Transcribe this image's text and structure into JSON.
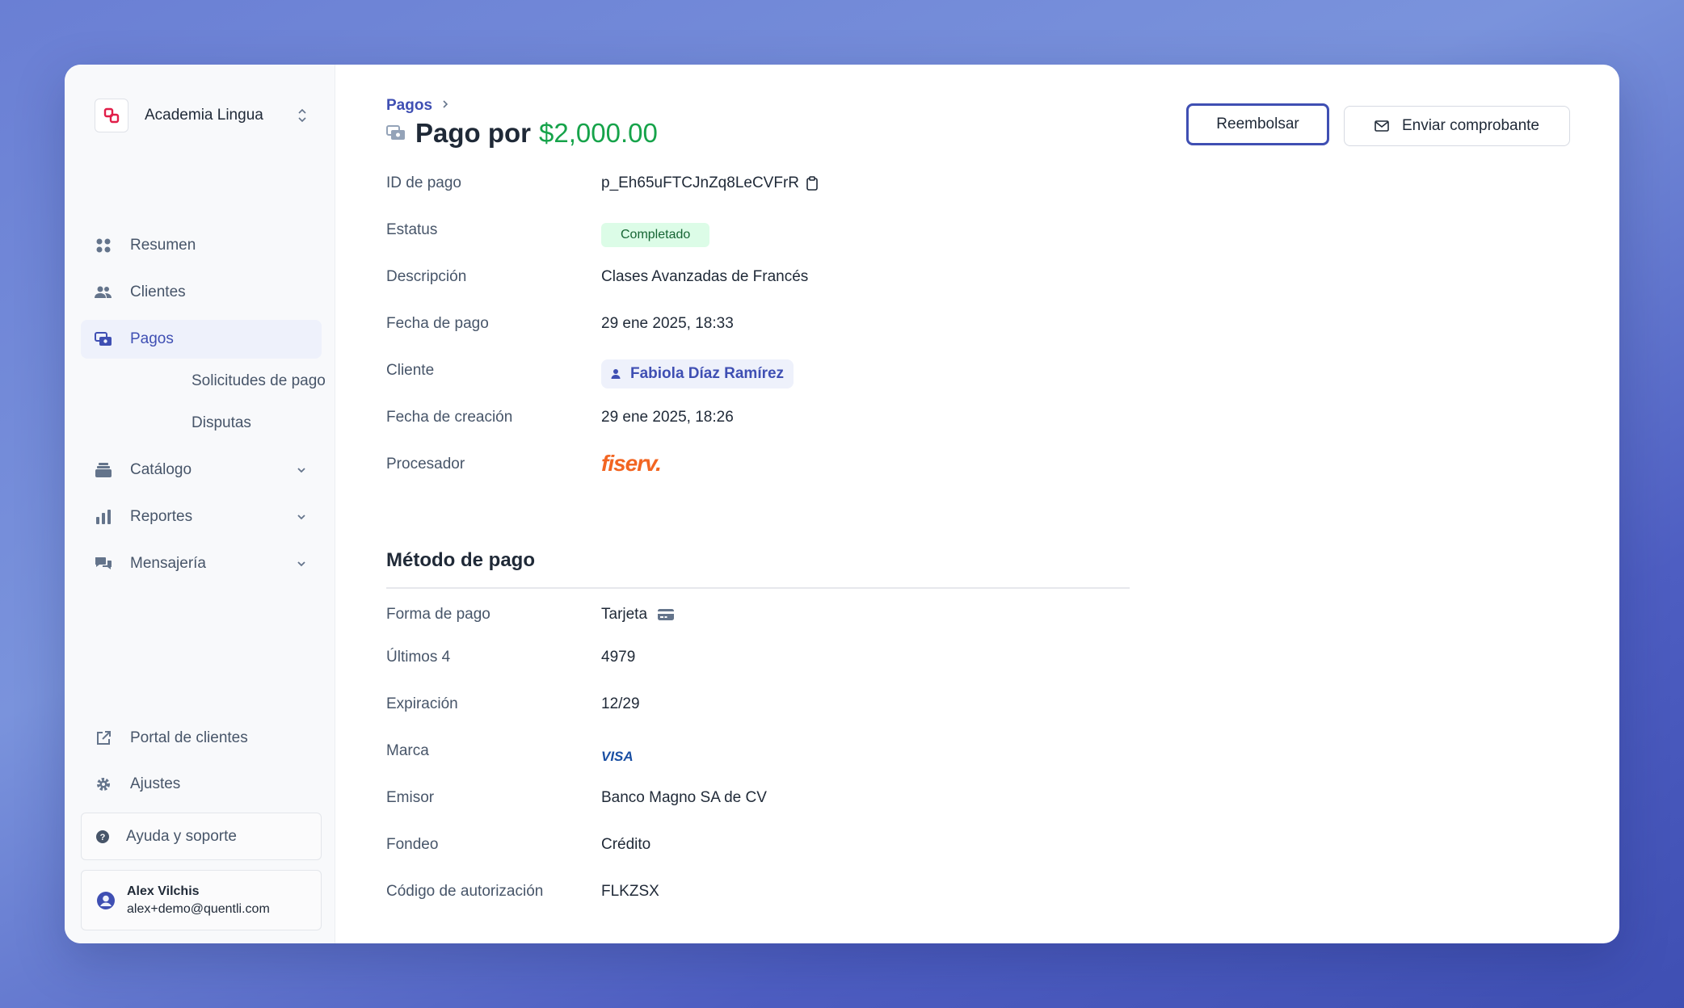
{
  "sidebar": {
    "org_name": "Academia Lingua",
    "nav": {
      "resumen": "Resumen",
      "clientes": "Clientes",
      "pagos": "Pagos",
      "solicitudes": "Solicitudes de pago",
      "disputas": "Disputas",
      "catalogo": "Catálogo",
      "reportes": "Reportes",
      "mensajeria": "Mensajería",
      "portal": "Portal de clientes",
      "ajustes": "Ajustes"
    },
    "help": "Ayuda y soporte",
    "user": {
      "name": "Alex Vilchis",
      "email": "alex+demo@quentli.com"
    }
  },
  "header": {
    "breadcrumb": "Pagos",
    "title": "Pago por",
    "amount": "$2,000.00",
    "refund_button": "Reembolsar",
    "receipt_button": "Enviar comprobante"
  },
  "details": {
    "id_label": "ID de pago",
    "id_value": "p_Eh65uFTCJnZq8LeCVFrR",
    "status_label": "Estatus",
    "status_value": "Completado",
    "description_label": "Descripción",
    "description_value": "Clases Avanzadas de Francés",
    "payment_date_label": "Fecha de pago",
    "payment_date_value": "29 ene 2025, 18:33",
    "client_label": "Cliente",
    "client_value": "Fabiola Díaz Ramírez",
    "created_label": "Fecha de creación",
    "created_value": "29 ene 2025, 18:26",
    "processor_label": "Procesador",
    "processor_value": "fiserv."
  },
  "payment_method": {
    "title": "Método de pago",
    "form_label": "Forma de pago",
    "form_value": "Tarjeta",
    "last4_label": "Últimos 4",
    "last4_value": "4979",
    "expiry_label": "Expiración",
    "expiry_value": "12/29",
    "brand_label": "Marca",
    "brand_value": "VISA",
    "issuer_label": "Emisor",
    "issuer_value": "Banco Magno SA de CV",
    "funding_label": "Fondeo",
    "funding_value": "Crédito",
    "auth_label": "Código de autorización",
    "auth_value": "FLKZSX"
  },
  "colors": {
    "accent": "#3f4fb3",
    "amount_green": "#16a34a",
    "status_bg": "#dcfce7",
    "fiserv_orange": "#f26522"
  }
}
